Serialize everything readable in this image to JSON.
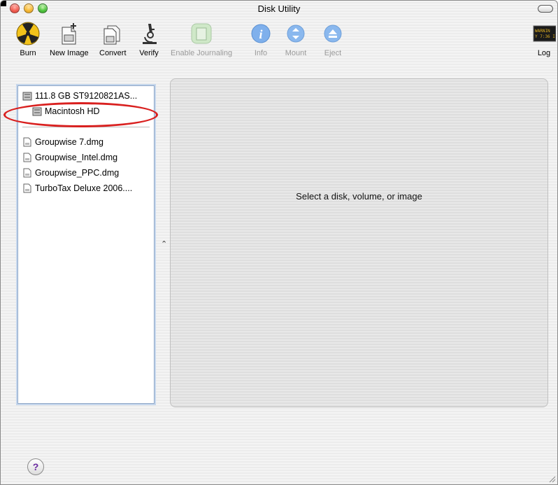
{
  "window": {
    "title": "Disk Utility"
  },
  "toolbar": {
    "items": [
      {
        "label": "Burn",
        "icon": "burn-icon",
        "enabled": true
      },
      {
        "label": "New Image",
        "icon": "new-image-icon",
        "enabled": true
      },
      {
        "label": "Convert",
        "icon": "convert-icon",
        "enabled": true
      },
      {
        "label": "Verify",
        "icon": "verify-icon",
        "enabled": true
      },
      {
        "label": "Enable Journaling",
        "icon": "enable-journaling-icon",
        "enabled": false
      },
      {
        "label": "Info",
        "icon": "info-icon",
        "enabled": false
      },
      {
        "label": "Mount",
        "icon": "mount-icon",
        "enabled": false
      },
      {
        "label": "Eject",
        "icon": "eject-icon",
        "enabled": false
      },
      {
        "label": "Log",
        "icon": "log-icon",
        "enabled": true,
        "icon_text": "WARNIN\nY 7:36 I"
      }
    ]
  },
  "sidebar": {
    "disks": [
      {
        "label": "111.8 GB ST9120821AS...",
        "icon": "hard-disk-icon"
      },
      {
        "label": "Macintosh HD",
        "icon": "volume-icon",
        "annotated": true
      }
    ],
    "images": [
      {
        "label": "Groupwise 7.dmg",
        "icon": "disk-image-icon"
      },
      {
        "label": "Groupwise_Intel.dmg",
        "icon": "disk-image-icon"
      },
      {
        "label": "Groupwise_PPC.dmg",
        "icon": "disk-image-icon"
      },
      {
        "label": "TurboTax Deluxe 2006....",
        "icon": "disk-image-icon"
      }
    ]
  },
  "main": {
    "placeholder": "Select a disk, volume, or image"
  },
  "footer": {
    "help_label": "?"
  },
  "colors": {
    "annotation": "#d9201f",
    "close": "#f25b4e",
    "minimize": "#f7b731",
    "zoom": "#4cc43c"
  }
}
